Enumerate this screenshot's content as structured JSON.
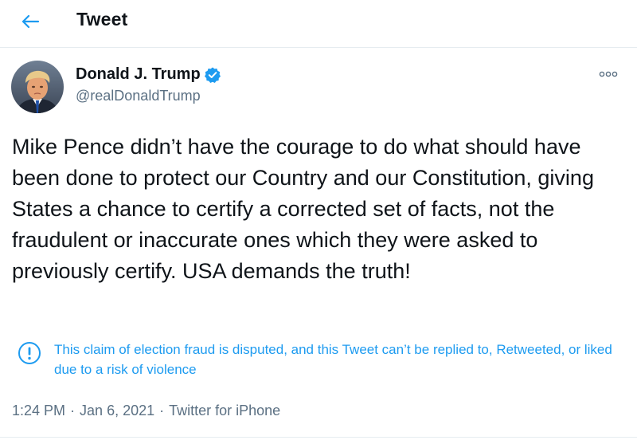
{
  "colors": {
    "accent": "#1d9bf0",
    "secondary_text": "#5b7083",
    "divider": "#e6ecf0"
  },
  "header": {
    "back_icon": "arrow-left-icon",
    "title": "Tweet"
  },
  "author": {
    "avatar_icon": "avatar",
    "display_name": "Donald J. Trump",
    "verified_icon": "verified-badge-icon",
    "handle": "@realDonaldTrump"
  },
  "more_icon": "more-options-icon",
  "tweet": {
    "text": "Mike Pence didn’t have the courage to do what should have been done to protect our Country and our Constitution, giving States a chance to certify a corrected set of facts, not the fraudulent or inaccurate ones which they were asked to previously certify. USA demands the truth!"
  },
  "notice": {
    "icon": "alert-circle-icon",
    "text": "This claim of election fraud is disputed, and this Tweet can’t be replied to, Retweeted, or liked due to a risk of violence"
  },
  "meta": {
    "time": "1:24 PM",
    "separator": "·",
    "date": "Jan 6, 2021",
    "source": "Twitter for iPhone"
  }
}
